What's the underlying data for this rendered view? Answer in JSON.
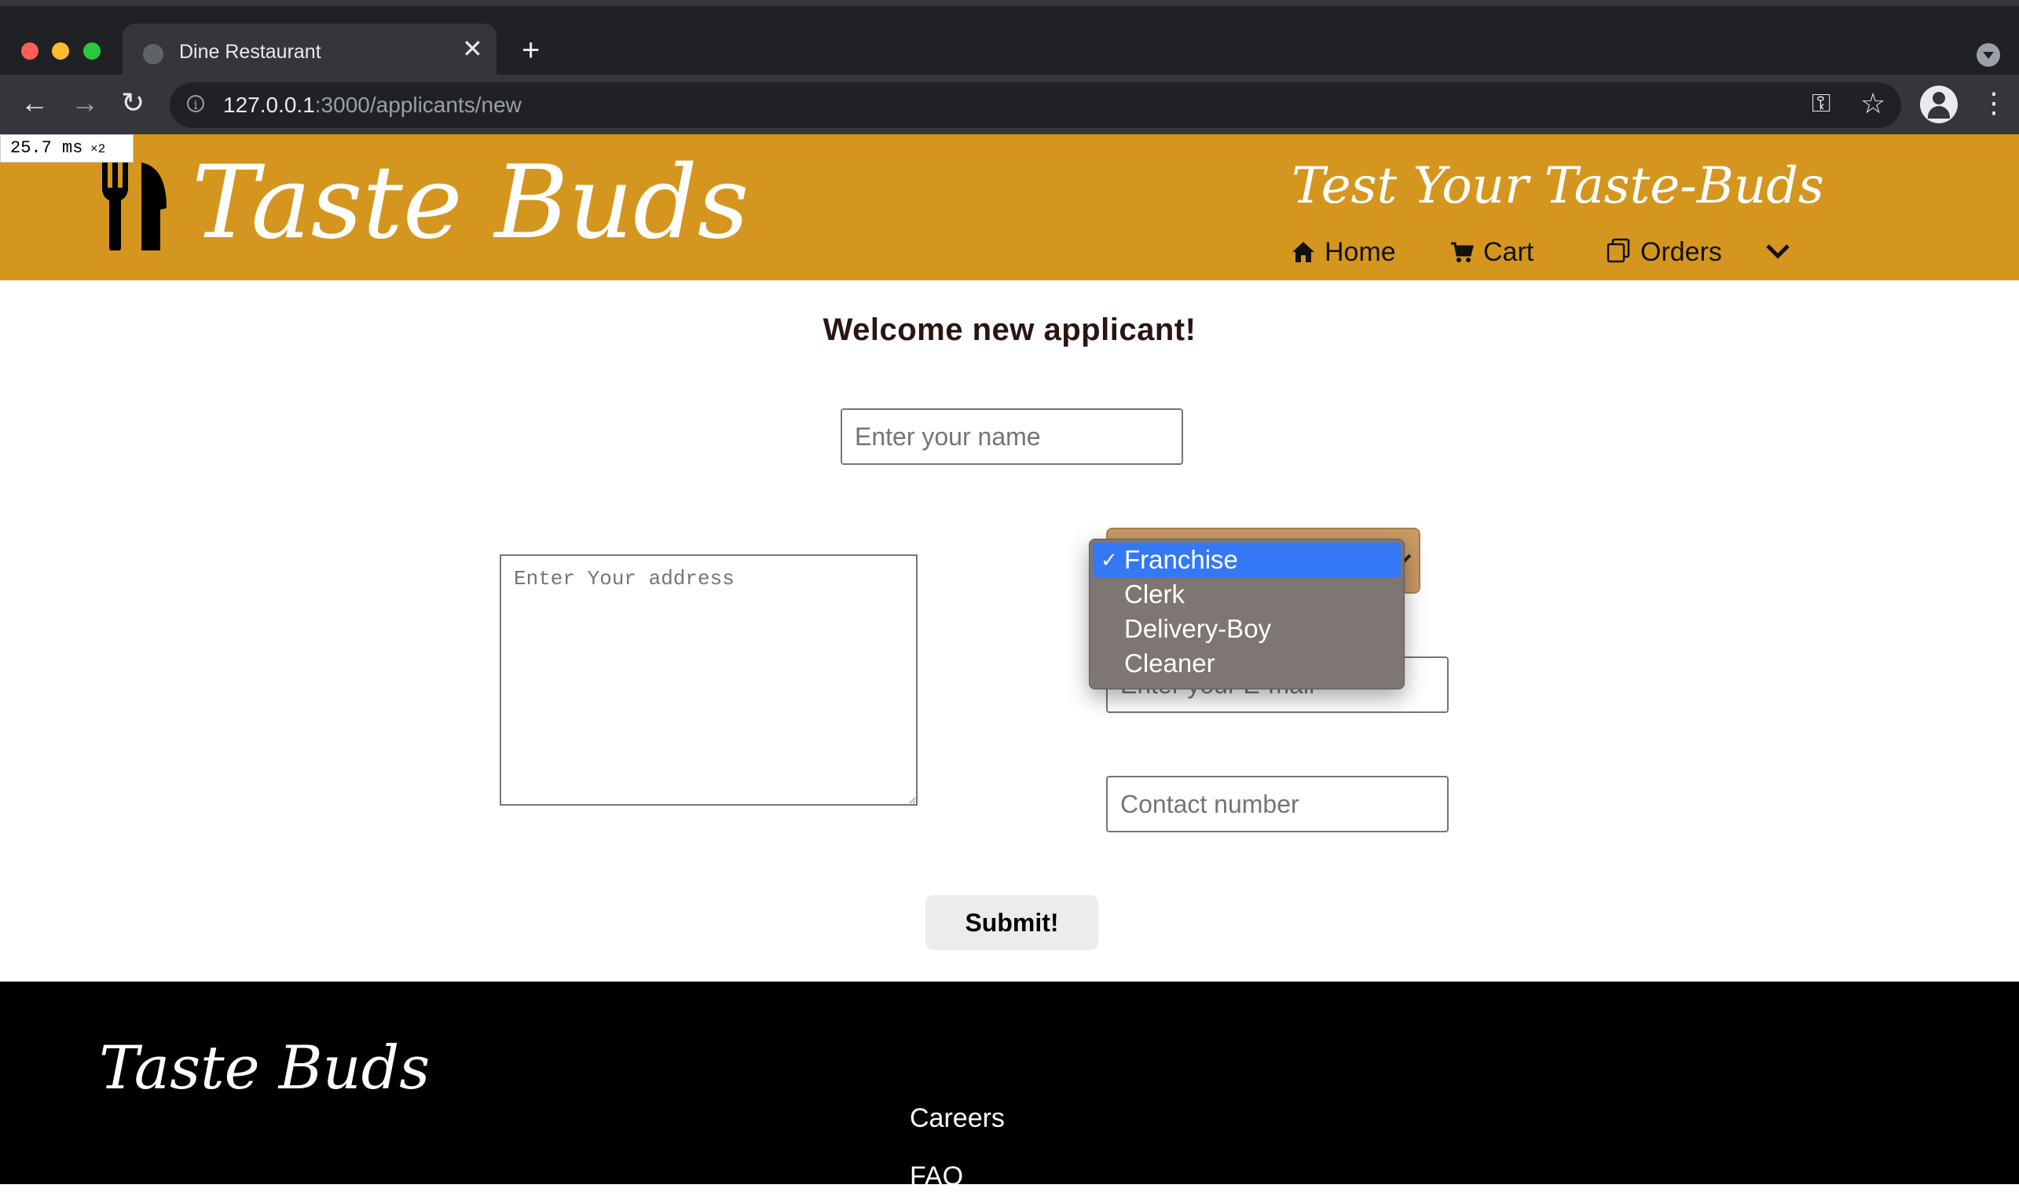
{
  "browser": {
    "tab_title": "Dine Restaurant",
    "tab_close": "✕",
    "new_tab": "+",
    "url_host": "127.0.0.1",
    "url_path": ":3000/applicants/new",
    "info_glyph": "i",
    "back_glyph": "←",
    "forward_glyph": "→",
    "reload_glyph": "↻",
    "menu_glyph": "⋮",
    "key_glyph": "⚿",
    "star_glyph": "☆"
  },
  "perf_badge": {
    "value": "25.7",
    "unit": " ms",
    "multiplier": " ×2"
  },
  "header": {
    "brand": "Taste Buds",
    "tagline": "Test Your Taste-Buds",
    "nav": {
      "home": "Home",
      "cart": "Cart",
      "orders": "Orders"
    }
  },
  "form": {
    "heading": "Welcome new applicant!",
    "name_placeholder": "Enter your name",
    "address_placeholder": "Enter Your address",
    "email_placeholder": "Enter your E-mail",
    "contact_placeholder": "Contact number",
    "role_options": [
      "Franchise",
      "Clerk",
      "Delivery-Boy",
      "Cleaner"
    ],
    "role_selected": "Franchise",
    "check_glyph": "✓",
    "submit_label": "Submit!"
  },
  "footer": {
    "brand": "Taste Buds",
    "links": {
      "careers": "Careers",
      "faq": "FAQ"
    }
  },
  "colors": {
    "header_bg": "#d4961f",
    "footer_bg": "#000000",
    "select_bg": "#c99b67",
    "menu_bg": "#7d7672",
    "menu_highlight": "#3478f6"
  }
}
